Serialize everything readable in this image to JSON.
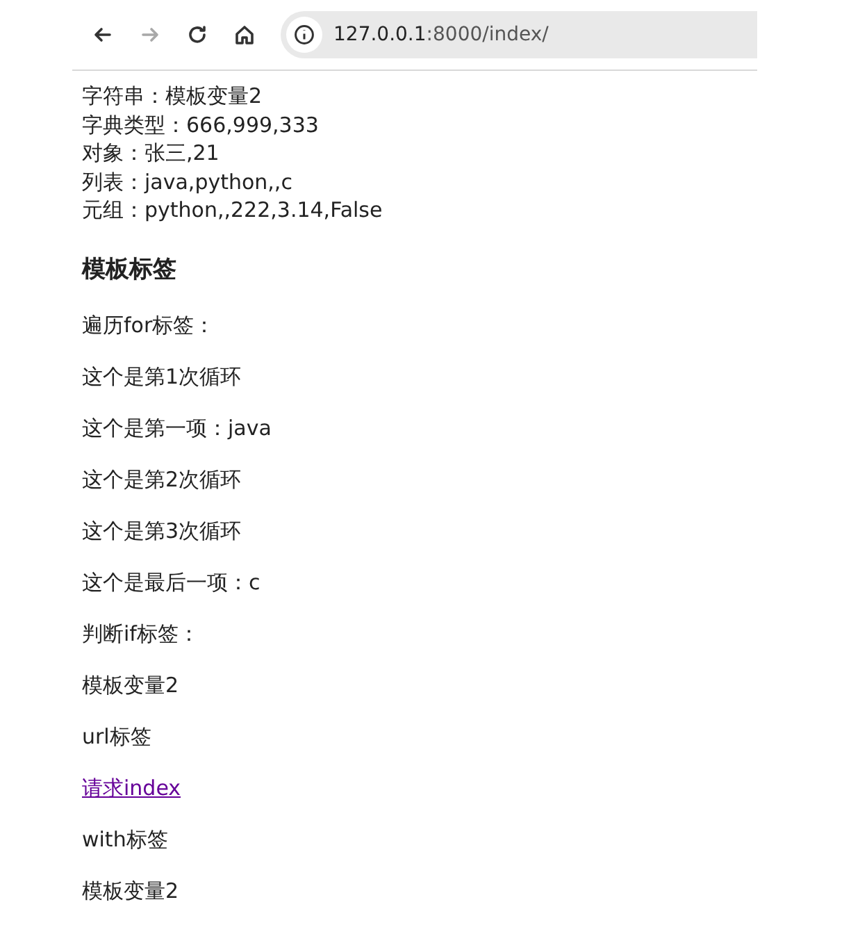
{
  "toolbar": {
    "buttons": [
      {
        "kind": "back",
        "disabled": false
      },
      {
        "kind": "forward",
        "disabled": true
      },
      {
        "kind": "reload",
        "disabled": false
      },
      {
        "kind": "home",
        "disabled": false
      }
    ],
    "address": {
      "host": "127.0.0.1",
      "path": ":8000/index/"
    }
  },
  "variables": [
    "字符串：模板变量2",
    "字典类型：666,999,333",
    "对象：张三,21",
    "列表：java,python,,c",
    "元组：python,,222,3.14,False"
  ],
  "heading": "模板标签",
  "paragraphs": [
    {
      "kind": "text",
      "text": "遍历for标签："
    },
    {
      "kind": "text",
      "text": "这个是第1次循环"
    },
    {
      "kind": "text",
      "text": "这个是第一项：java"
    },
    {
      "kind": "text",
      "text": "这个是第2次循环"
    },
    {
      "kind": "text",
      "text": "这个是第3次循环"
    },
    {
      "kind": "text",
      "text": "这个是最后一项：c"
    },
    {
      "kind": "text",
      "text": "判断if标签："
    },
    {
      "kind": "text",
      "text": "模板变量2"
    },
    {
      "kind": "text",
      "text": "url标签"
    },
    {
      "kind": "link",
      "text": "请求index"
    },
    {
      "kind": "text",
      "text": "with标签"
    },
    {
      "kind": "text",
      "text": "模板变量2"
    }
  ]
}
